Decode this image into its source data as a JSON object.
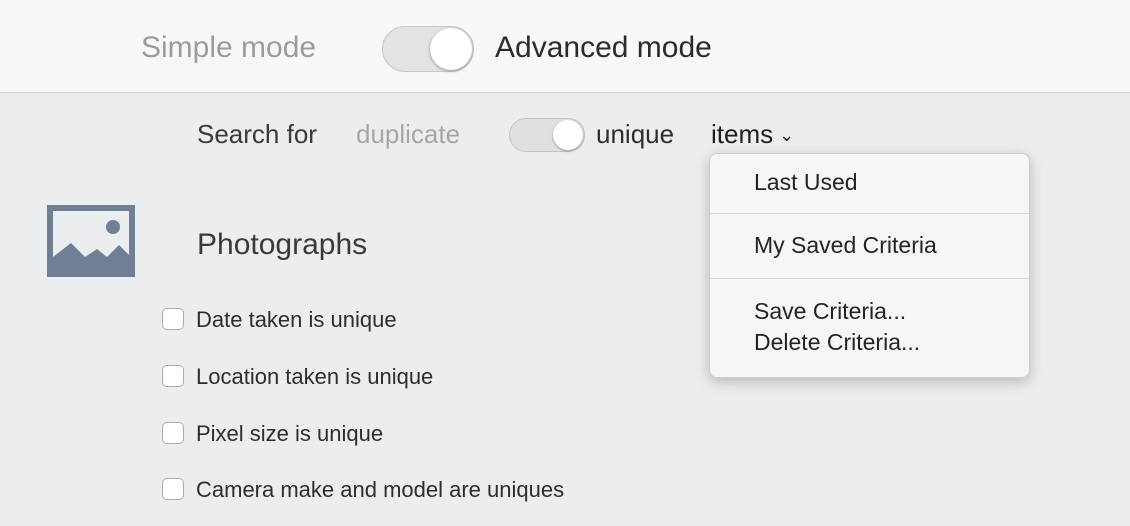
{
  "mode_switch": {
    "simple_label": "Simple mode",
    "advanced_label": "Advanced mode",
    "state": "advanced"
  },
  "search": {
    "prefix": "Search for",
    "duplicate_label": "duplicate",
    "unique_label": "unique",
    "items_label": "items",
    "items_chevron": "⌄",
    "state": "unique"
  },
  "section": {
    "title": "Photographs",
    "icon": "photo-icon",
    "options": [
      {
        "label": "Date taken is unique",
        "checked": false
      },
      {
        "label": "Location taken is unique",
        "checked": false
      },
      {
        "label": "Pixel size is unique",
        "checked": false
      },
      {
        "label": "Camera make and model are uniques",
        "checked": false
      }
    ]
  },
  "menu": {
    "items": [
      {
        "label": "Last Used"
      },
      {
        "label": "My Saved Criteria"
      },
      {
        "label": "Save Criteria..."
      },
      {
        "label": "Delete Criteria..."
      }
    ]
  },
  "colors": {
    "top_bar": "#f8f8f9",
    "panel": "#ecedef",
    "icon": "#6f7f96",
    "muted_text": "#9a9ca0"
  }
}
